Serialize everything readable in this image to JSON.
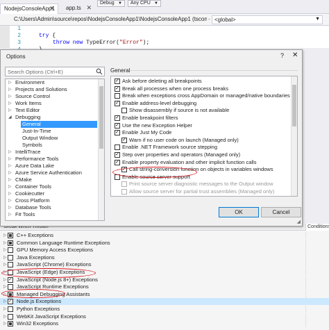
{
  "window": {
    "doc_tabs": [
      {
        "label": "NodejsConsoleApp1",
        "close": "✕"
      },
      {
        "label": "app.ts",
        "close": "✕"
      }
    ],
    "toolbar_config": "Debug",
    "toolbar_platform": "Any CPU",
    "path": "C:\\Users\\Admin\\source\\repos\\NodejsConsoleApp1\\NodejsConsoleApp1 (tsconfig or jscc",
    "path_sep": "-",
    "namespace": "<global>"
  },
  "editor": {
    "lines": [
      {
        "num": "1",
        "text": ""
      },
      {
        "num": "2",
        "kw": "try",
        "rest": " {"
      },
      {
        "num": "3",
        "kw": "throw new",
        "rest": " TypeError(",
        "str": "\"Error\"",
        "end": ");"
      },
      {
        "num": "4",
        "text": "}"
      }
    ]
  },
  "dialog": {
    "title": "Options",
    "help": "?",
    "close": "✕",
    "search_placeholder": "Search Options (Ctrl+E)",
    "section": "General",
    "tree": [
      {
        "label": "Environment",
        "exp": "▷",
        "child": false,
        "selected": false
      },
      {
        "label": "Projects and Solutions",
        "exp": "▷",
        "child": false,
        "selected": false
      },
      {
        "label": "Source Control",
        "exp": "▷",
        "child": false,
        "selected": false
      },
      {
        "label": "Work Items",
        "exp": "▷",
        "child": false,
        "selected": false
      },
      {
        "label": "Text Editor",
        "exp": "▷",
        "child": false,
        "selected": false
      },
      {
        "label": "Debugging",
        "exp": "◢",
        "child": false,
        "selected": false
      },
      {
        "label": "General",
        "exp": "",
        "child": true,
        "selected": true
      },
      {
        "label": "Just-In-Time",
        "exp": "",
        "child": true,
        "selected": false
      },
      {
        "label": "Output Window",
        "exp": "",
        "child": true,
        "selected": false
      },
      {
        "label": "Symbols",
        "exp": "",
        "child": true,
        "selected": false
      },
      {
        "label": "IntelliTrace",
        "exp": "▷",
        "child": false,
        "selected": false
      },
      {
        "label": "Performance Tools",
        "exp": "▷",
        "child": false,
        "selected": false
      },
      {
        "label": "Azure Data Lake",
        "exp": "▷",
        "child": false,
        "selected": false
      },
      {
        "label": "Azure Service Authentication",
        "exp": "▷",
        "child": false,
        "selected": false
      },
      {
        "label": "CMake",
        "exp": "▷",
        "child": false,
        "selected": false
      },
      {
        "label": "Container Tools",
        "exp": "▷",
        "child": false,
        "selected": false
      },
      {
        "label": "Cookiecutter",
        "exp": "▷",
        "child": false,
        "selected": false
      },
      {
        "label": "Cross Platform",
        "exp": "▷",
        "child": false,
        "selected": false
      },
      {
        "label": "Database Tools",
        "exp": "▷",
        "child": false,
        "selected": false
      },
      {
        "label": "F# Tools",
        "exp": "▷",
        "child": false,
        "selected": false
      }
    ],
    "options": [
      {
        "label": "Ask before deleting all breakpoints",
        "checked": true,
        "indent": 0,
        "disabled": false
      },
      {
        "label": "Break all processes when one process breaks",
        "checked": true,
        "indent": 0,
        "disabled": false
      },
      {
        "label": "Break when exceptions cross AppDomain or managed/native boundaries (Managed o",
        "checked": false,
        "indent": 0,
        "disabled": false
      },
      {
        "label": "Enable address-level debugging",
        "checked": true,
        "indent": 0,
        "disabled": false
      },
      {
        "label": "Show disassembly if source is not available",
        "checked": false,
        "indent": 1,
        "disabled": false
      },
      {
        "label": "Enable breakpoint filters",
        "checked": true,
        "indent": 0,
        "disabled": false
      },
      {
        "label": "Use the new Exception Helper",
        "checked": true,
        "indent": 0,
        "disabled": false
      },
      {
        "label": "Enable Just My Code",
        "checked": true,
        "indent": 0,
        "disabled": false
      },
      {
        "label": "Warn if no user code on launch (Managed only)",
        "checked": true,
        "indent": 1,
        "disabled": false
      },
      {
        "label": "Enable .NET Framework source stepping",
        "checked": false,
        "indent": 0,
        "disabled": false
      },
      {
        "label": "Step over properties and operators (Managed only)",
        "checked": true,
        "indent": 0,
        "disabled": false
      },
      {
        "label": "Enable property evaluation and other implicit function calls",
        "checked": true,
        "indent": 0,
        "disabled": false
      },
      {
        "label": "Call string-conversion function on objects in variables windows",
        "checked": true,
        "indent": 1,
        "disabled": false
      },
      {
        "label": "Enable source server support",
        "checked": false,
        "indent": 0,
        "disabled": false
      },
      {
        "label": "Print source server diagnostic messages to the Output window",
        "checked": false,
        "indent": 1,
        "disabled": true
      },
      {
        "label": "Allow source server for partial trust assemblies (Managed only)",
        "checked": false,
        "indent": 1,
        "disabled": true
      }
    ],
    "ok_label": "OK",
    "cancel_label": "Cancel",
    "check_mark": "✓"
  },
  "exceptions": {
    "column_name": "Break When Thrown",
    "column_conditions": "Conditions",
    "rows": [
      {
        "label": "C++ Exceptions",
        "state": "partial",
        "selected": false
      },
      {
        "label": "Common Language Runtime Exceptions",
        "state": "partial",
        "selected": false
      },
      {
        "label": "GPU Memory Access Exceptions",
        "state": "empty",
        "selected": false
      },
      {
        "label": "Java Exceptions",
        "state": "empty",
        "selected": false
      },
      {
        "label": "JavaScript (Chrome) Exceptions",
        "state": "empty",
        "selected": false
      },
      {
        "label": "JavaScript (Edge) Exceptions",
        "state": "empty",
        "selected": false
      },
      {
        "label": "JavaScript (Node.js 8+) Exceptions",
        "state": "checked",
        "selected": false
      },
      {
        "label": "JavaScript Runtime Exceptions",
        "state": "empty",
        "selected": false
      },
      {
        "label": "Managed Debugging Assistants",
        "state": "partial",
        "selected": false
      },
      {
        "label": "Node.js Exceptions",
        "state": "checked",
        "selected": true
      },
      {
        "label": "Python Exceptions",
        "state": "empty",
        "selected": false
      },
      {
        "label": "WebKit JavaScript Exceptions",
        "state": "empty",
        "selected": false
      },
      {
        "label": "Win32 Exceptions",
        "state": "partial",
        "selected": false
      }
    ],
    "expand_glyph": "▷"
  }
}
